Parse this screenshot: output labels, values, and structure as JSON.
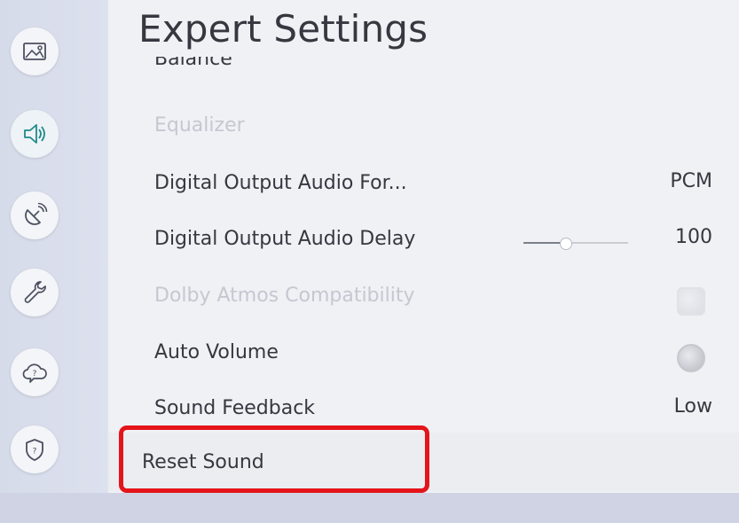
{
  "header": {
    "title": "Expert Settings"
  },
  "sidebar": {
    "items": [
      {
        "icon": "picture-icon"
      },
      {
        "icon": "sound-icon"
      },
      {
        "icon": "broadcasting-icon"
      },
      {
        "icon": "general-wrench-icon"
      },
      {
        "icon": "support-cloud-icon"
      },
      {
        "icon": "privacy-shield-icon"
      }
    ]
  },
  "settings": {
    "balance_label": "Balance",
    "equalizer_label": "Equalizer",
    "digital_output_format_label": "Digital Output Audio For...",
    "digital_output_format_value": "PCM",
    "digital_output_delay_label": "Digital Output Audio Delay",
    "digital_output_delay_value": "100",
    "digital_output_delay_level": 0.4,
    "dolby_atmos_label": "Dolby Atmos Compatibility",
    "auto_volume_label": "Auto Volume",
    "sound_feedback_label": "Sound Feedback",
    "sound_feedback_value": "Low",
    "reset_sound_label": "Reset Sound"
  },
  "colors": {
    "highlight": "#e4141a",
    "text": "#35383f",
    "disabled_text": "#c4c8d0"
  }
}
